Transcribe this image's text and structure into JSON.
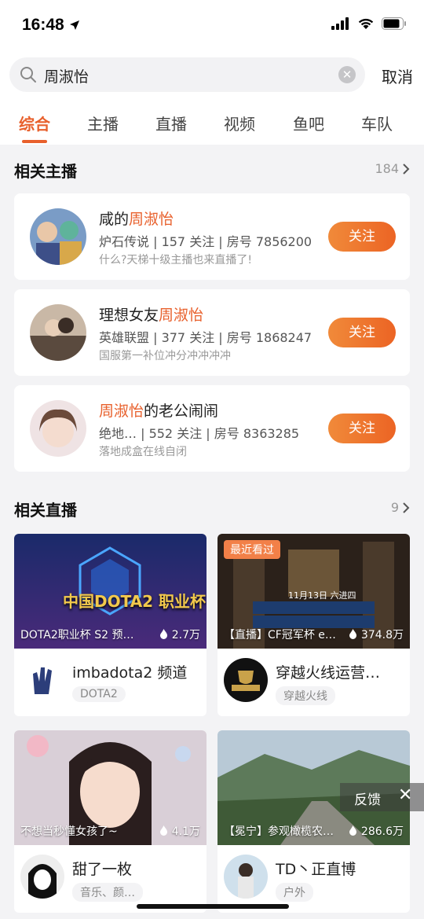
{
  "status": {
    "time": "16:48"
  },
  "search": {
    "query": "周淑怡",
    "cancel": "取消"
  },
  "tabs": [
    {
      "label": "综合"
    },
    {
      "label": "主播"
    },
    {
      "label": "直播"
    },
    {
      "label": "视频"
    },
    {
      "label": "鱼吧"
    },
    {
      "label": "车队"
    }
  ],
  "streamers_section": {
    "title": "相关主播",
    "count": "184"
  },
  "streamers": [
    {
      "name_pre": "咸的",
      "name_hl": "周淑怡",
      "name_post": "",
      "info": "炉石传说 | 157 关注 | 房号 7856200",
      "desc": "什么?天梯十级主播也来直播了!",
      "follow": "关注"
    },
    {
      "name_pre": "理想女友",
      "name_hl": "周淑怡",
      "name_post": "",
      "info": "英雄联盟 | 377 关注 | 房号 1868247",
      "desc": "国服第一补位冲分冲冲冲冲",
      "follow": "关注"
    },
    {
      "name_pre": "",
      "name_hl": "周淑怡",
      "name_post": "的老公闹闹",
      "info": "绝地… | 552 关注 | 房号 8363285",
      "desc": "落地成盒在线自闭",
      "follow": "关注"
    }
  ],
  "live_section": {
    "title": "相关直播",
    "count": "9"
  },
  "lives": [
    {
      "title": "DOTA2职业杯 S2 预…",
      "views": "2.7万",
      "badge": "",
      "thumb_text": "中国DOTA2 职业杯",
      "streamer": "imbadota2 频道",
      "tag": "DOTA2"
    },
    {
      "title": "【直播】CF冠军杯 e…",
      "views": "374.8万",
      "badge": "最近看过",
      "thumb_text": "11月13日 六进四",
      "streamer": "穿越火线运营…",
      "tag": "穿越火线"
    },
    {
      "title": "不想当秒懂女孩了~",
      "views": "4.1万",
      "badge": "",
      "thumb_text": "",
      "streamer": "甜了一枚",
      "tag": "音乐、颜…"
    },
    {
      "title": "【冕宁】参观橄榄农…",
      "views": "286.6万",
      "badge": "",
      "thumb_text": "",
      "streamer": "TD丶正直博",
      "tag": "户外"
    }
  ],
  "feedback": {
    "label": "反馈"
  },
  "colors": {
    "accent": "#e8602c"
  }
}
